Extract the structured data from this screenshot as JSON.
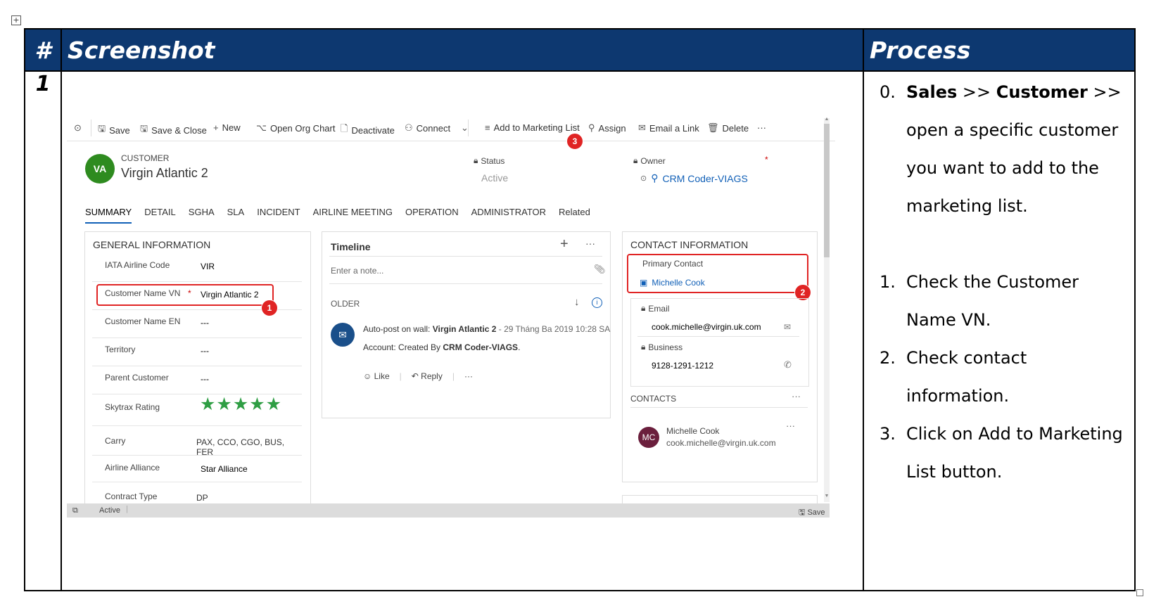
{
  "table": {
    "headers": {
      "num": "#",
      "screenshot": "Screenshot",
      "process": "Process"
    },
    "row_number": "1"
  },
  "screenshot": {
    "command_bar": {
      "items": [
        {
          "label": "Save",
          "icon": "save-icon"
        },
        {
          "label": "Save & Close",
          "icon": "save-close-icon"
        },
        {
          "label": "New",
          "icon": "plus-icon"
        },
        {
          "label": "Open Org Chart",
          "icon": "org-chart-icon"
        },
        {
          "label": "Deactivate",
          "icon": "deactivate-icon"
        },
        {
          "label": "Connect",
          "icon": "connect-icon"
        },
        {
          "label": "Add to Marketing List",
          "icon": "marketing-list-icon"
        },
        {
          "label": "Assign",
          "icon": "assign-icon"
        },
        {
          "label": "Email a Link",
          "icon": "email-icon"
        },
        {
          "label": "Delete",
          "icon": "delete-icon"
        }
      ],
      "more": "···"
    },
    "header": {
      "avatar": "VA",
      "entity_type": "CUSTOMER",
      "record_name": "Virgin Atlantic 2",
      "status_label": "Status",
      "status_value": "Active",
      "owner_label": "Owner",
      "owner_value": "CRM Coder-VIAGS",
      "required_mark": "*"
    },
    "tabs": [
      "SUMMARY",
      "DETAIL",
      "SGHA",
      "SLA",
      "INCIDENT",
      "AIRLINE MEETING",
      "OPERATION",
      "ADMINISTRATOR",
      "Related"
    ],
    "general": {
      "title": "GENERAL INFORMATION",
      "fields": [
        {
          "label": "IATA Airline Code",
          "value": "VIR"
        },
        {
          "label": "Customer Name VN",
          "value": "Virgin Atlantic 2",
          "required": "*"
        },
        {
          "label": "Customer Name EN",
          "value": "---"
        },
        {
          "label": "Territory",
          "value": "---"
        },
        {
          "label": "Parent Customer",
          "value": "---"
        },
        {
          "label": "Skytrax Rating",
          "value": "★★★★★"
        },
        {
          "label": "Carry",
          "value": "PAX, CCO, CGO, BUS, FER"
        },
        {
          "label": "Airline Alliance",
          "value": "Star Alliance"
        },
        {
          "label": "Contract Type",
          "value": "DP"
        }
      ]
    },
    "timeline": {
      "title": "Timeline",
      "note_placeholder": "Enter a note...",
      "older": "OLDER",
      "post_prefix": "Auto-post on wall: ",
      "post_subject": "Virgin Atlantic 2",
      "post_date": " - 29 Tháng Ba 2019 10:28 SA",
      "post_account_prefix": "Account: Created By ",
      "post_account_user": "CRM Coder-VIAGS",
      "post_account_suffix": ".",
      "like": "Like",
      "reply": "Reply",
      "more": "···"
    },
    "contact": {
      "title": "CONTACT INFORMATION",
      "primary_label": "Primary Contact",
      "primary_value": "Michelle Cook",
      "email_label": "Email",
      "email_value": "cook.michelle@virgin.uk.com",
      "business_label": "Business",
      "business_value": "9128-1291-1212",
      "contacts_title": "CONTACTS",
      "contacts_more": "···",
      "contact_avatar": "MC",
      "contact_name": "Michelle Cook",
      "contact_email": "cook.michelle@virgin.uk.com"
    },
    "status_bar": {
      "status": "Active",
      "save": "Save"
    },
    "badges": [
      "1",
      "2",
      "3"
    ],
    "accent_color": "#1160b7",
    "annotation_color": "#e02424"
  },
  "process": {
    "steps": [
      {
        "num": "0.",
        "bold1": "Sales",
        "sep1": " >> ",
        "bold2": "Customer",
        "sep2": " >>",
        "text": " open a specific customer you want to add to the marketing list."
      },
      {
        "num": "1.",
        "text": "Check the Customer Name VN."
      },
      {
        "num": "2.",
        "text": "Check contact information."
      },
      {
        "num": "3.",
        "text": "Click on Add to Marketing List button."
      }
    ]
  },
  "colors": {
    "header_bg": "#0d3870",
    "header_text": "#ffffff"
  }
}
